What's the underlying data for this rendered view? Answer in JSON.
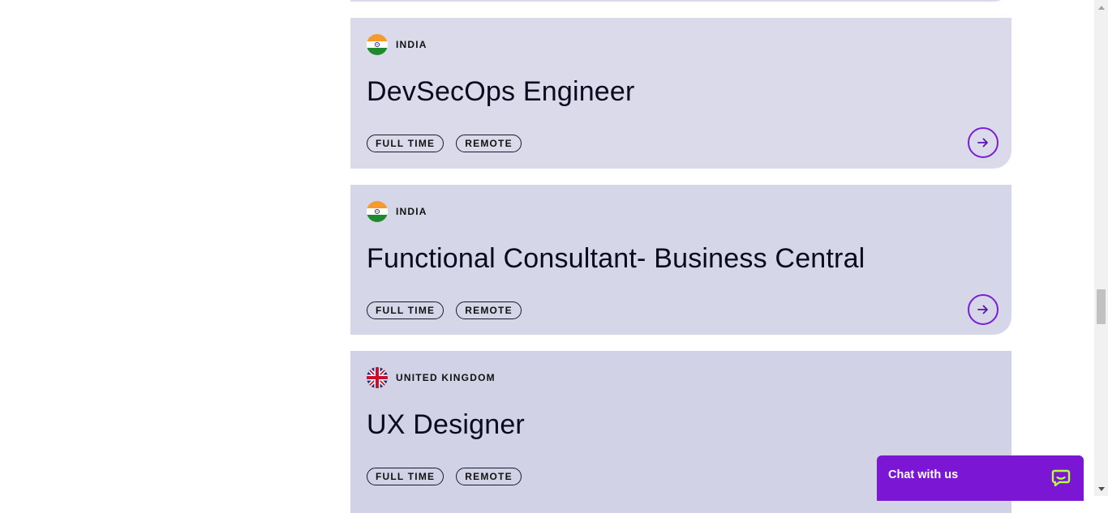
{
  "jobs": [
    {
      "location": "INDIA",
      "flag_icon": "india-flag-icon",
      "title": "DevSecOps Engineer",
      "tags": [
        "FULL TIME",
        "REMOTE"
      ]
    },
    {
      "location": "INDIA",
      "flag_icon": "india-flag-icon",
      "title": "Functional Consultant- Business Central",
      "tags": [
        "FULL TIME",
        "REMOTE"
      ]
    },
    {
      "location": "UNITED KINGDOM",
      "flag_icon": "uk-flag-icon",
      "title": "UX Designer",
      "tags": [
        "FULL TIME",
        "REMOTE"
      ]
    }
  ],
  "chat": {
    "label": "Chat with us",
    "icon": "chat-bubble-icon"
  },
  "colors": {
    "card_bg": "#d8d9ea",
    "accent": "#7a1fd6",
    "chat_bg": "#7a16d4"
  }
}
